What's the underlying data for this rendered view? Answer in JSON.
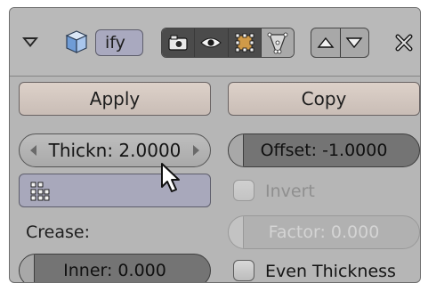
{
  "header": {
    "object_name": "ify",
    "icons": [
      "collapse-triangle-icon",
      "cube-icon",
      "camera-icon",
      "eye-icon",
      "vertex-select-icon",
      "edit-cage-icon",
      "move-up-icon",
      "move-down-icon",
      "close-icon"
    ]
  },
  "actions": {
    "apply": "Apply",
    "copy": "Copy"
  },
  "fields": {
    "thickness": "Thickn: 2.0000",
    "offset": "Offset: -1.0000",
    "offset_value": -1.0,
    "factor": "Factor: 0.000",
    "inner": "Inner: 0.000"
  },
  "labels": {
    "crease": "Crease:"
  },
  "checkboxes": {
    "invert": {
      "label": "Invert",
      "checked": false,
      "enabled": false
    },
    "even_thickness": {
      "label": "Even Thickness",
      "checked": false,
      "enabled": true
    }
  },
  "colors": {
    "panel_bg": "#b6b6b6",
    "button_bg": "#d6cac3",
    "name_field_bg": "#a9a9bf",
    "slider_bg": "#747474"
  }
}
